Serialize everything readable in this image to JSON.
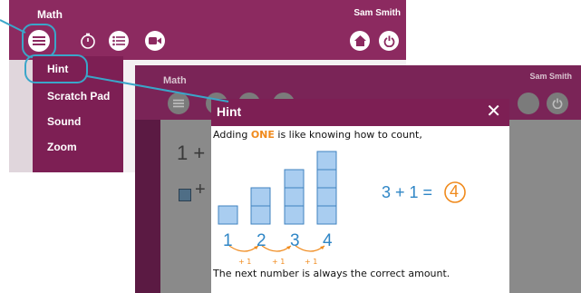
{
  "back_window": {
    "title": "Math",
    "user": "Sam Smith",
    "menu": [
      "Hint",
      "Scratch Pad",
      "Sound",
      "Zoom"
    ]
  },
  "front_window": {
    "title": "Math",
    "user": "Sam Smith",
    "bg_text_1": "1 +",
    "bg_text_2": "+"
  },
  "hint": {
    "title": "Hint",
    "close": "✕",
    "line_start": "Adding ",
    "line_keyword": "ONE",
    "line_end": " is like knowing how to count,",
    "equation_left": "3 + 1 =",
    "equation_answer": "4",
    "numbers": [
      "1",
      "2",
      "3",
      "4"
    ],
    "step_label": "+ 1",
    "footer": "The next number is always the correct amount."
  },
  "colors": {
    "header": "#8c2a60",
    "menu_bg": "#7d1f54",
    "callout": "#3aa6c9",
    "highlight": "#f08a1c",
    "number_blue": "#2f86c6",
    "block_fill": "#a9cdf0"
  }
}
